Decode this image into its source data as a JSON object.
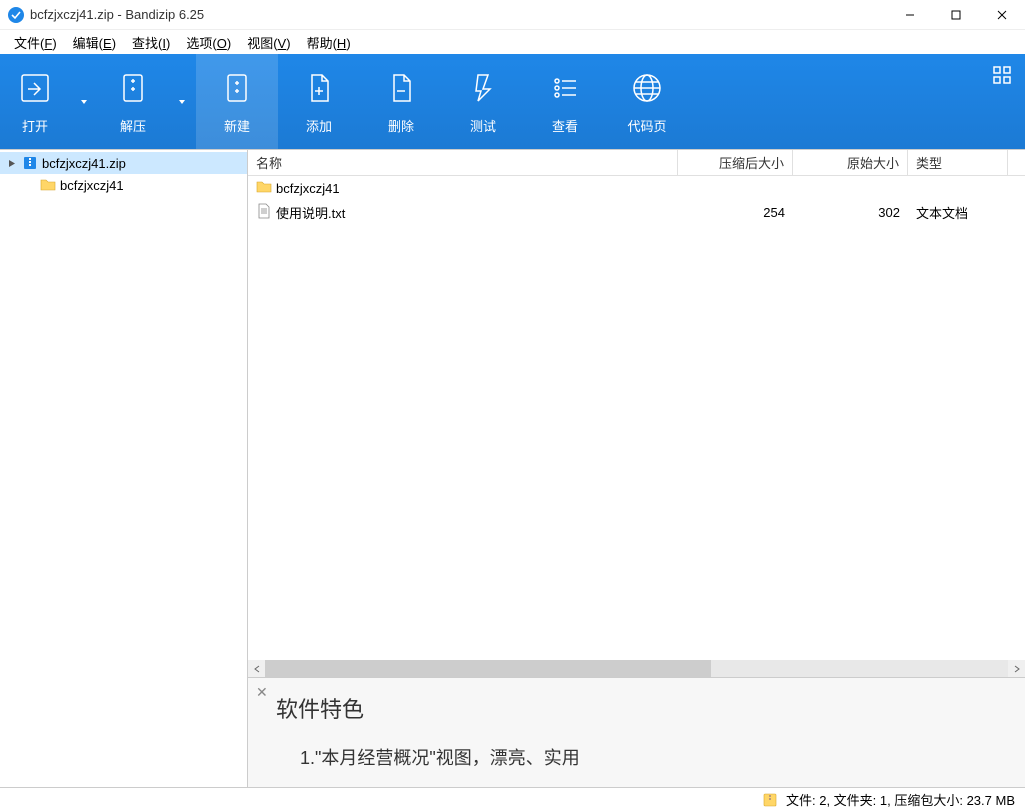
{
  "app": {
    "title": "bcfzjxczj41.zip - Bandizip 6.25"
  },
  "menu": {
    "file": {
      "label": "文件",
      "key": "F"
    },
    "edit": {
      "label": "编辑",
      "key": "E"
    },
    "find": {
      "label": "查找",
      "key": "I"
    },
    "option": {
      "label": "选项",
      "key": "O"
    },
    "view": {
      "label": "视图",
      "key": "V"
    },
    "help": {
      "label": "帮助",
      "key": "H"
    }
  },
  "toolbar": {
    "open": "打开",
    "extract": "解压",
    "new": "新建",
    "add": "添加",
    "delete": "删除",
    "test": "测试",
    "viewbtn": "查看",
    "codepage": "代码页"
  },
  "tree": {
    "root": "bcfzjxczj41.zip",
    "child": "bcfzjxczj41"
  },
  "columns": {
    "name": "名称",
    "compressed": "压缩后大小",
    "original": "原始大小",
    "type": "类型"
  },
  "rows": [
    {
      "name": "bcfzjxczj41",
      "compressed": "",
      "original": "",
      "type": "",
      "icon": "folder"
    },
    {
      "name": "使用说明.txt",
      "compressed": "254",
      "original": "302",
      "type": "文本文档",
      "icon": "txt"
    }
  ],
  "preview": {
    "title": "软件特色",
    "line1": "1.\"本月经营概况\"视图，漂亮、实用"
  },
  "status": {
    "text": "文件: 2, 文件夹: 1, 压缩包大小: 23.7 MB"
  }
}
